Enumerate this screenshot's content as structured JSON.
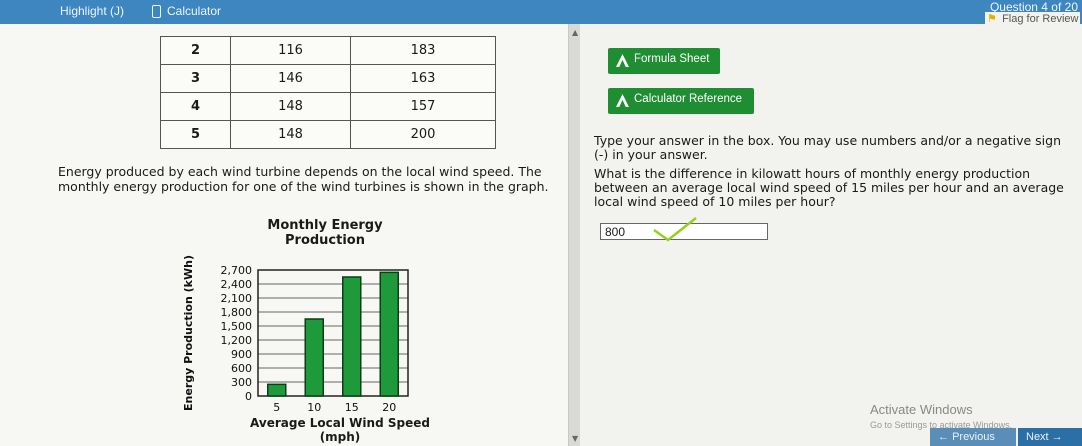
{
  "toolbar": {
    "highlight_label": "Highlight (J)",
    "calculator_label": "Calculator",
    "question_counter": "Question 4 of 20",
    "flag_label": "Flag for Review"
  },
  "table": {
    "rows": [
      [
        "2",
        "116",
        "183"
      ],
      [
        "3",
        "146",
        "163"
      ],
      [
        "4",
        "148",
        "157"
      ],
      [
        "5",
        "148",
        "200"
      ]
    ]
  },
  "passage": {
    "text": "Energy produced by each wind turbine depends on the local wind speed. The monthly energy production for one of the wind turbines is shown in the graph."
  },
  "chart_data": {
    "type": "bar",
    "title": "Monthly Energy Production",
    "xlabel": "Average Local Wind Speed (mph)",
    "ylabel": "Energy Production (kWh)",
    "x": [
      5,
      10,
      15,
      20
    ],
    "x_ticks": [
      "5",
      "10",
      "15",
      "20"
    ],
    "y_ticks": [
      "0",
      "300",
      "600",
      "900",
      "1,200",
      "1,500",
      "1,800",
      "2,100",
      "2,400",
      "2,700"
    ],
    "values": [
      250,
      1650,
      2550,
      2650
    ],
    "ylim": [
      0,
      2700
    ],
    "grid": true,
    "bar_color": "#1f9a3a"
  },
  "reference": {
    "formula_sheet": "Formula Sheet",
    "calculator_reference": "Calculator Reference"
  },
  "instructions": "Type your answer in the box. You may use numbers and/or a negative sign (-) in your answer.",
  "question": "What is the difference in kilowatt hours of monthly energy production between an average local wind speed of 15 miles per hour and an average local wind speed of 10 miles per hour?",
  "answer": {
    "value": "800"
  },
  "windows": {
    "activate_title": "Activate Windows",
    "activate_sub": "Go to Settings to activate Windows."
  },
  "nav": {
    "previous": "Previous",
    "next": "Next"
  },
  "colors": {
    "topbar": "#3d86bf",
    "button_green": "#1f8e33",
    "check_green": "#8fd41c"
  }
}
